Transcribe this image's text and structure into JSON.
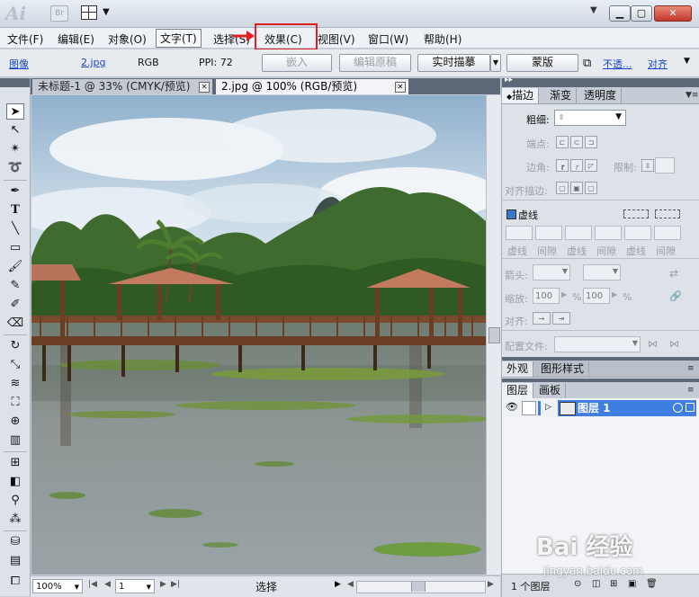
{
  "titlebar": {
    "app_logo": "Ai",
    "bridge": "Br",
    "colors": {
      "close": "#c2372a"
    }
  },
  "menu": {
    "items": [
      "文件(F)",
      "编辑(E)",
      "对象(O)",
      "文字(T)",
      "选择(S)",
      "效果(C)",
      "视图(V)",
      "窗口(W)",
      "帮助(H)"
    ],
    "highlight_color": "#e02020"
  },
  "control": {
    "image_label": "图像",
    "file_name": "2.jpg",
    "color_mode": "RGB",
    "ppi": "PPI: 72",
    "embed": "嵌入",
    "edit_original": "编辑原稿",
    "live_trace": "实时描摹",
    "mask": "蒙版",
    "opacity": "不透...",
    "align": "对齐"
  },
  "tabs": [
    {
      "label": "未标题-1 @ 33% (CMYK/预览)"
    },
    {
      "label": "2.jpg @ 100% (RGB/预览)"
    }
  ],
  "status": {
    "zoom": "100%",
    "artboard": "1",
    "tool": "选择"
  },
  "stroke_panel": {
    "tabs": [
      "描边",
      "渐变",
      "透明度"
    ],
    "weight": "粗细:",
    "cap": "端点:",
    "corner": "边角:",
    "limit": "限制:",
    "align": "对齐描边:",
    "dashed": "虚线",
    "dash_labels": [
      "虚线",
      "间隙",
      "虚线",
      "间隙",
      "虚线",
      "间隙"
    ],
    "arrowheads": "箭头:",
    "scale": "缩放:",
    "scale_start": "100",
    "scale_end": "100",
    "pct": "%",
    "align_arrows": "对齐:",
    "profile": "配置文件:"
  },
  "appearance_panel": {
    "tabs": [
      "外观",
      "图形样式"
    ]
  },
  "layers_panel": {
    "tabs": [
      "图层",
      "画板"
    ],
    "layer_name": "图层 1",
    "count": "1 个图层",
    "accent": "#3d7ee0"
  },
  "watermark": {
    "logo": "Bai 经验",
    "url": "jingyan.baidu.com"
  }
}
